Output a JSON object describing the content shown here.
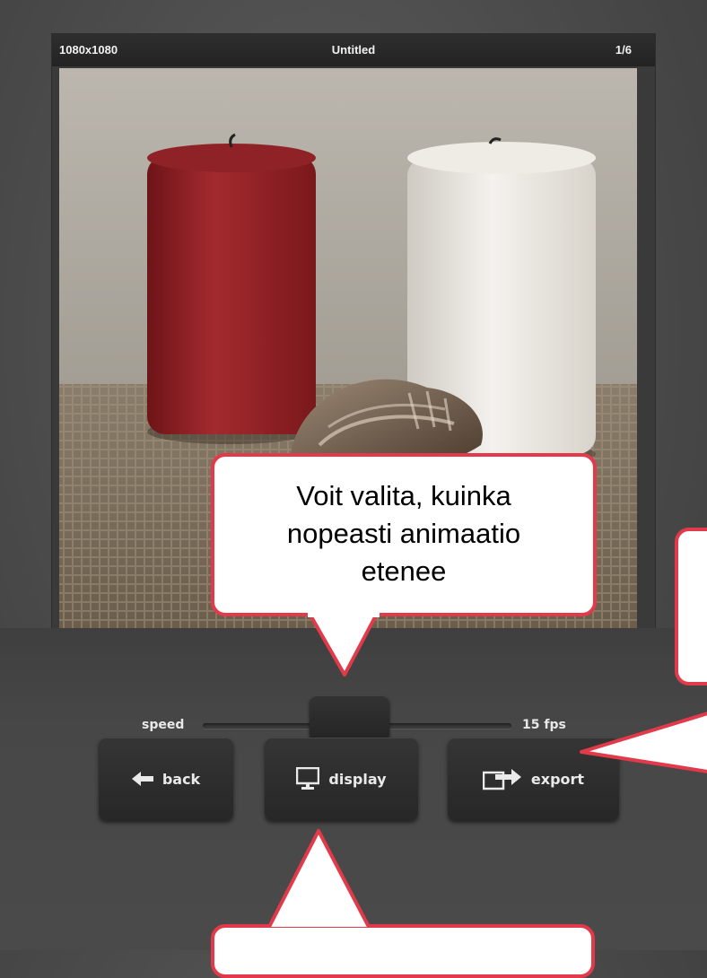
{
  "header": {
    "resolution": "1080x1080",
    "title": "Untitled",
    "frame_counter": "1/6"
  },
  "slider": {
    "label": "speed",
    "value_label": "15 fps"
  },
  "buttons": {
    "back": "back",
    "display": "display",
    "export": "export"
  },
  "callouts": {
    "speed_line1": "Voit valita, kuinka",
    "speed_line2": "nopeasti animaatio",
    "speed_line3": "etenee"
  },
  "icons": [
    "back-arrow-icon",
    "monitor-icon",
    "export-icon"
  ],
  "colors": {
    "callout_border": "#e23a4a",
    "background": "#4a4a4a"
  }
}
